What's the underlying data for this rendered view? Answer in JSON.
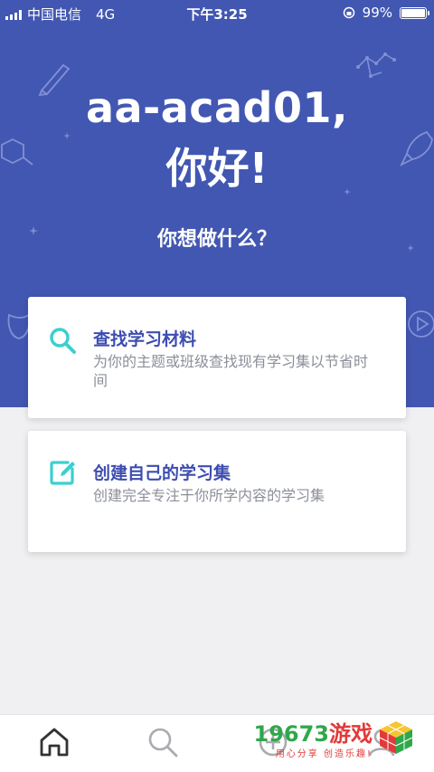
{
  "status_bar": {
    "carrier": "中国电信",
    "network": "4G",
    "time": "下午3:25",
    "battery_percent": "99%",
    "battery_level": 0.99
  },
  "greeting": {
    "name": "aa-acad01,",
    "hello": "你好!",
    "question": "你想做什么？"
  },
  "cards": [
    {
      "title": "查找学习材料",
      "description": "为你的主题或班级查找现有学习集以节省时间",
      "icon": "search-icon"
    },
    {
      "title": "创建自己的学习集",
      "description": "创建完全专注于你所学内容的学习集",
      "icon": "edit-icon"
    }
  ],
  "tab_bar": {
    "tabs": [
      "home-icon",
      "search-icon",
      "add-icon",
      "profile-icon"
    ]
  },
  "watermark": {
    "brand_number": "19673",
    "brand_text": "游戏",
    "slogan": "用心分享 创造乐趣!"
  },
  "colors": {
    "hero_bg": "#4257b2",
    "accent_teal": "#3ccfcf",
    "card_title": "#3d4db0",
    "page_bg": "#f0f0f2"
  }
}
